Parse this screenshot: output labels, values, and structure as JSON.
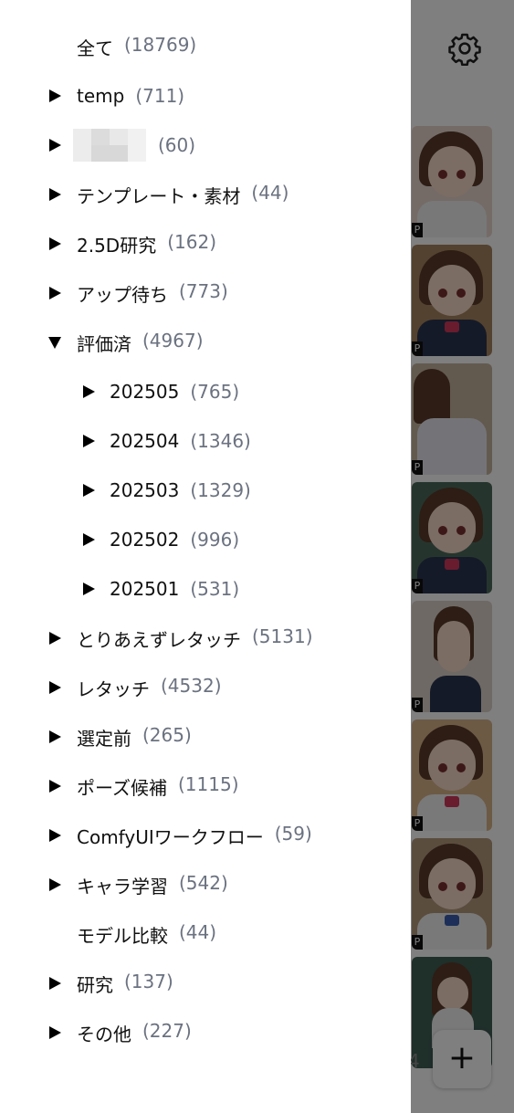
{
  "background": {
    "settings_icon": "gear-icon",
    "fab_label": "+",
    "partial_count": "4"
  },
  "drawer": {
    "items": [
      {
        "label": "全て",
        "count": "(18769)",
        "arrow": "none"
      },
      {
        "label": "temp",
        "count": "(711)",
        "arrow": "right"
      },
      {
        "label": "",
        "count": "(60)",
        "arrow": "right",
        "blurred": true
      },
      {
        "label": "テンプレート・素材",
        "count": "(44)",
        "arrow": "right"
      },
      {
        "label": "2.5D研究",
        "count": "(162)",
        "arrow": "right"
      },
      {
        "label": "アップ待ち",
        "count": "(773)",
        "arrow": "right"
      },
      {
        "label": "評価済",
        "count": "(4967)",
        "arrow": "down"
      },
      {
        "label": "202505",
        "count": "(765)",
        "arrow": "right",
        "child": true
      },
      {
        "label": "202504",
        "count": "(1346)",
        "arrow": "right",
        "child": true
      },
      {
        "label": "202503",
        "count": "(1329)",
        "arrow": "right",
        "child": true
      },
      {
        "label": "202502",
        "count": "(996)",
        "arrow": "right",
        "child": true
      },
      {
        "label": "202501",
        "count": "(531)",
        "arrow": "right",
        "child": true
      },
      {
        "label": "とりあえずレタッチ",
        "count": "(5131)",
        "arrow": "right"
      },
      {
        "label": "レタッチ",
        "count": "(4532)",
        "arrow": "right"
      },
      {
        "label": "選定前",
        "count": "(265)",
        "arrow": "right"
      },
      {
        "label": "ポーズ候補",
        "count": "(1115)",
        "arrow": "right"
      },
      {
        "label": "ComfyUIワークフロー",
        "count": "(59)",
        "arrow": "right"
      },
      {
        "label": "キャラ学習",
        "count": "(542)",
        "arrow": "right"
      },
      {
        "label": "モデル比較",
        "count": "(44)",
        "arrow": "none"
      },
      {
        "label": "研究",
        "count": "(137)",
        "arrow": "right"
      },
      {
        "label": "その他",
        "count": "(227)",
        "arrow": "right"
      }
    ]
  },
  "colors": {
    "label": "#111111",
    "count": "#6b7280",
    "overlay": "rgba(0,0,0,0.5)"
  }
}
